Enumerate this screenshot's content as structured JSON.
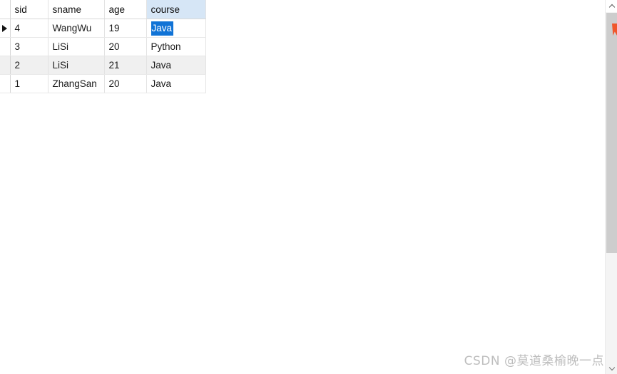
{
  "grid": {
    "columns": [
      {
        "key": "indicator",
        "label": ""
      },
      {
        "key": "sid",
        "label": "sid"
      },
      {
        "key": "sname",
        "label": "sname"
      },
      {
        "key": "age",
        "label": "age"
      },
      {
        "key": "course",
        "label": "course"
      }
    ],
    "selected_column": "course",
    "selected_cell_value": "Java",
    "current_row_index": 0,
    "rows": [
      {
        "sid": "4",
        "sname": "WangWu",
        "age": "19",
        "course": "Java"
      },
      {
        "sid": "3",
        "sname": "LiSi",
        "age": "20",
        "course": "Python"
      },
      {
        "sid": "2",
        "sname": "LiSi",
        "age": "21",
        "course": "Java"
      },
      {
        "sid": "1",
        "sname": "ZhangSan",
        "age": "20",
        "course": "Java"
      }
    ]
  },
  "scrollbar": {
    "up_icon": "chevron-up-icon",
    "down_icon": "chevron-down-icon",
    "marker_color": "#f0562b"
  },
  "colors": {
    "selection_blue": "#1073d6",
    "header_selected_blue": "#d6e6f6",
    "row_indicator_blue": "#cfe3f7",
    "alt_row_gray": "#f0f0f0",
    "edit_border_orange": "#e8a866"
  },
  "watermark": {
    "text": "CSDN @莫道桑榆晚一点"
  }
}
